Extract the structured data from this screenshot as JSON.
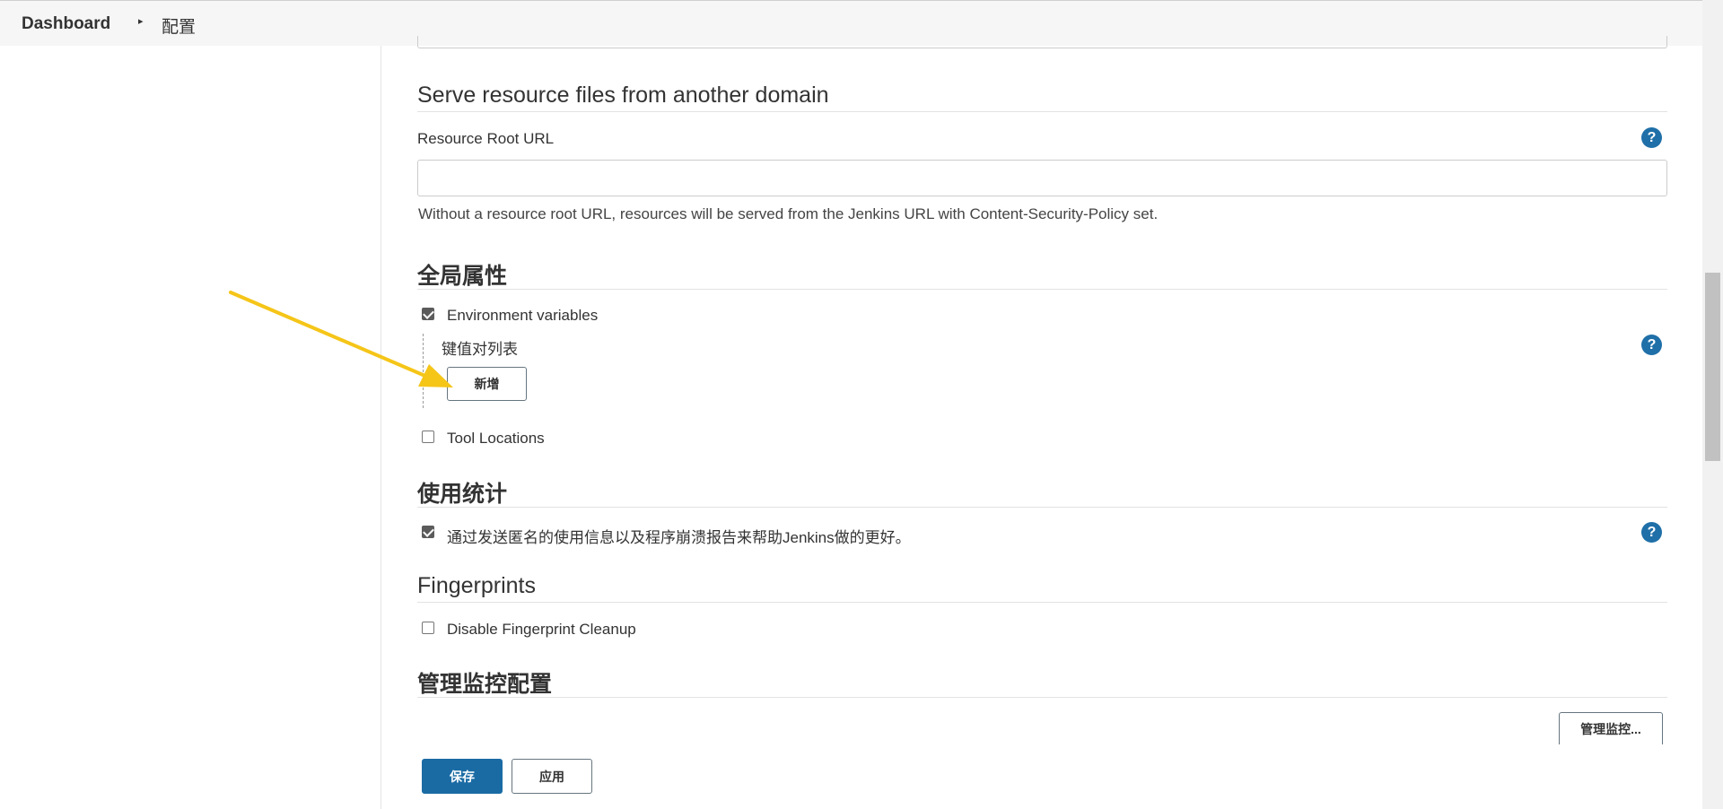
{
  "breadcrumb": {
    "home": "Dashboard",
    "separator": "▸",
    "current": "配置"
  },
  "resource_section": {
    "heading": "Serve resource files from another domain",
    "field_label": "Resource Root URL",
    "input_value": "",
    "help_text": "Without a resource root URL, resources will be served from the Jenkins URL with Content-Security-Policy set."
  },
  "global_props": {
    "heading": "全局属性",
    "env_vars_label": "Environment variables",
    "env_vars_checked": true,
    "kv_list_label": "键值对列表",
    "add_button": "新增",
    "tool_locations_label": "Tool Locations",
    "tool_locations_checked": false
  },
  "usage": {
    "heading": "使用统计",
    "anon_label": "通过发送匿名的使用信息以及程序崩溃报告来帮助Jenkins做的更好。",
    "anon_checked": true
  },
  "fingerprints": {
    "heading": "Fingerprints",
    "disable_cleanup_label": "Disable Fingerprint Cleanup",
    "disable_cleanup_checked": false
  },
  "monitor": {
    "heading": "管理监控配置",
    "button": "管理监控..."
  },
  "footer": {
    "save_button": "保存",
    "apply_button": "应用"
  },
  "help_glyph": "?",
  "colors": {
    "primary": "#1a6ba4",
    "help_icon": "#1f6fa8",
    "annotation_arrow": "#f5c518"
  }
}
